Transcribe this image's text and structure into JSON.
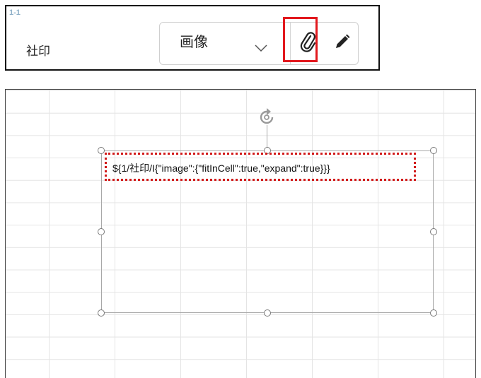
{
  "form": {
    "field_id": "1-1",
    "field_label": "社印",
    "type_select": {
      "value": "画像"
    },
    "icons": {
      "chevron": "chevron-down-icon",
      "attach": "paperclip-icon",
      "edit": "pencil-icon",
      "rotate": "rotate-icon"
    },
    "highlight_color": "#e2191e"
  },
  "sheet": {
    "text_box": {
      "text": "${1/社印/I{\"image\":{\"fitInCell\":true,\"expand\":true}}}"
    },
    "highlight_color": "#d21a1a"
  }
}
